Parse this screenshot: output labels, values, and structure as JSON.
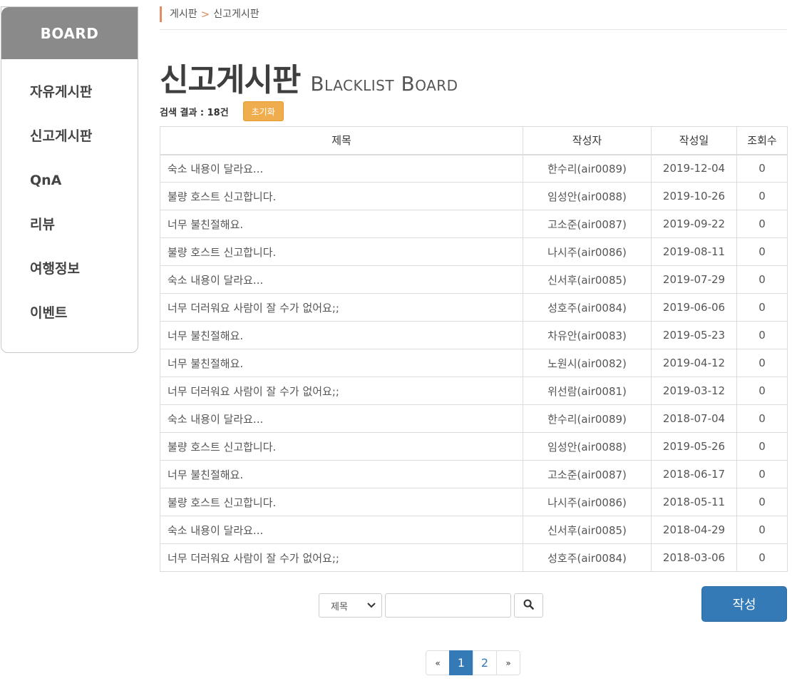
{
  "sidebar": {
    "heading": "BOARD",
    "items": [
      {
        "label": "자유게시판"
      },
      {
        "label": "신고게시판"
      },
      {
        "label": "QnA"
      },
      {
        "label": "리뷰"
      },
      {
        "label": "여행정보"
      },
      {
        "label": "이벤트"
      }
    ]
  },
  "breadcrumb": {
    "parent": "게시판",
    "separator": ">",
    "current": "신고게시판"
  },
  "header": {
    "title": "신고게시판",
    "subtitle": "Blacklist Board"
  },
  "result": {
    "text": "검색 결과 : 18건",
    "reset_label": "초기화"
  },
  "table": {
    "columns": {
      "title": "제목",
      "author": "작성자",
      "date": "작성일",
      "views": "조회수"
    },
    "rows": [
      {
        "title": "숙소 내용이 달라요...",
        "author": "한수리(air0089)",
        "date": "2019-12-04",
        "views": "0"
      },
      {
        "title": "불량 호스트 신고합니다.",
        "author": "임성안(air0088)",
        "date": "2019-10-26",
        "views": "0"
      },
      {
        "title": "너무 불친절해요.",
        "author": "고소준(air0087)",
        "date": "2019-09-22",
        "views": "0"
      },
      {
        "title": "불량 호스트 신고합니다.",
        "author": "나시주(air0086)",
        "date": "2019-08-11",
        "views": "0"
      },
      {
        "title": "숙소 내용이 달라요...",
        "author": "신서후(air0085)",
        "date": "2019-07-29",
        "views": "0"
      },
      {
        "title": "너무 더러워요 사람이 잘 수가 없어요;;",
        "author": "성호주(air0084)",
        "date": "2019-06-06",
        "views": "0"
      },
      {
        "title": "너무 불친절해요.",
        "author": "차유안(air0083)",
        "date": "2019-05-23",
        "views": "0"
      },
      {
        "title": "너무 불친절해요.",
        "author": "노원시(air0082)",
        "date": "2019-04-12",
        "views": "0"
      },
      {
        "title": "너무 더러워요 사람이 잘 수가 없어요;;",
        "author": "위선람(air0081)",
        "date": "2019-03-12",
        "views": "0"
      },
      {
        "title": "숙소 내용이 달라요...",
        "author": "한수리(air0089)",
        "date": "2018-07-04",
        "views": "0"
      },
      {
        "title": "불량 호스트 신고합니다.",
        "author": "임성안(air0088)",
        "date": "2019-05-26",
        "views": "0"
      },
      {
        "title": "너무 불친절해요.",
        "author": "고소준(air0087)",
        "date": "2018-06-17",
        "views": "0"
      },
      {
        "title": "불량 호스트 신고합니다.",
        "author": "나시주(air0086)",
        "date": "2018-05-11",
        "views": "0"
      },
      {
        "title": "숙소 내용이 달라요...",
        "author": "신서후(air0085)",
        "date": "2018-04-29",
        "views": "0"
      },
      {
        "title": "너무 더러워요 사람이 잘 수가 없어요;;",
        "author": "성호주(air0084)",
        "date": "2018-03-06",
        "views": "0"
      }
    ]
  },
  "search": {
    "select_value": "제목",
    "input_value": "",
    "icon": "search-icon"
  },
  "write_label": "작성",
  "pagination": {
    "prev": "«",
    "pages": [
      "1",
      "2"
    ],
    "active": "1",
    "next": "»"
  },
  "colors": {
    "primary": "#337ab7",
    "reset": "#f0ad4e",
    "sidebar_head": "#8a8a8a",
    "accent": "#e08d66"
  }
}
